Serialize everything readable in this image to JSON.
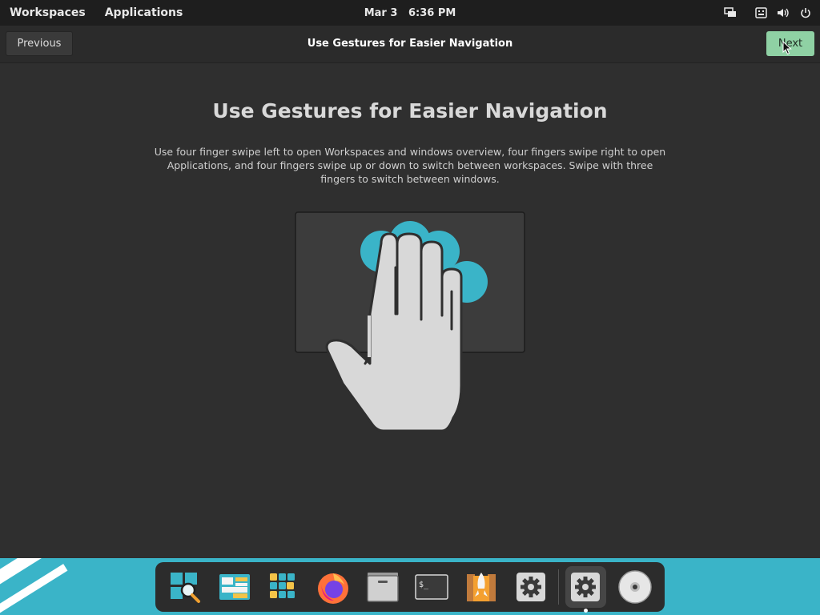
{
  "top_panel": {
    "workspaces_label": "Workspaces",
    "applications_label": "Applications",
    "date": "Mar 3",
    "time": "6:36 PM",
    "tray_icons": [
      "windows-icon",
      "keyboard-icon",
      "volume-icon",
      "power-icon"
    ]
  },
  "header": {
    "previous_label": "Previous",
    "title": "Use Gestures for Easier Navigation",
    "next_label": "Next"
  },
  "main": {
    "heading": "Use Gestures for Easier Navigation",
    "description": "Use four finger swipe left to open Workspaces and windows overview, four fingers swipe right to open Applications, and four fingers swipe up or down to switch between workspaces. Swipe with three fingers to switch between windows."
  },
  "dock": {
    "items": [
      {
        "name": "search-icon"
      },
      {
        "name": "workspaces-icon"
      },
      {
        "name": "app-grid-icon"
      },
      {
        "name": "firefox-icon"
      },
      {
        "name": "files-icon"
      },
      {
        "name": "terminal-icon"
      },
      {
        "name": "pop-shop-icon"
      },
      {
        "name": "settings-icon"
      },
      {
        "name": "settings-running-icon",
        "active": true
      },
      {
        "name": "disc-icon"
      }
    ]
  },
  "colors": {
    "accent_green": "#8fd1a4",
    "teal": "#3ab4c8",
    "background": "#2f2f2f"
  }
}
